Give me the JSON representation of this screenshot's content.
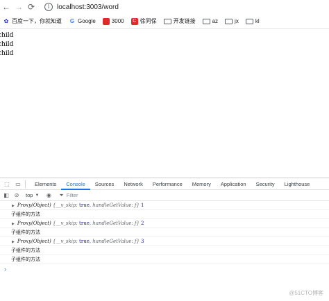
{
  "browser": {
    "back_icon": "←",
    "forward_icon": "→",
    "reload_icon": "⟳",
    "info_icon": "i",
    "url": "localhost:3003/word"
  },
  "bookmarks": [
    {
      "label": "百度一下，你就知道",
      "icon": "paw-icon",
      "glyph": "✿",
      "kind": "baidu"
    },
    {
      "label": "Google",
      "icon": "google-icon",
      "glyph": "G",
      "kind": "google"
    },
    {
      "label": "3000",
      "icon": "site-icon",
      "glyph": "",
      "kind": "red"
    },
    {
      "label": "徐同保",
      "icon": "csdn-icon",
      "glyph": "C",
      "kind": "red"
    },
    {
      "label": "开发链接",
      "icon": "folder-icon",
      "glyph": "",
      "kind": "folder"
    },
    {
      "label": "az",
      "icon": "folder-icon",
      "glyph": "",
      "kind": "folder"
    },
    {
      "label": "jx",
      "icon": "folder-icon",
      "glyph": "",
      "kind": "folder"
    },
    {
      "label": "kl",
      "icon": "folder-icon",
      "glyph": "",
      "kind": "folder"
    }
  ],
  "page": {
    "lines": [
      "child",
      "child",
      "child"
    ]
  },
  "devtools": {
    "tabs": [
      {
        "label": "Elements",
        "active": false
      },
      {
        "label": "Console",
        "active": true
      },
      {
        "label": "Sources",
        "active": false
      },
      {
        "label": "Network",
        "active": false
      },
      {
        "label": "Performance",
        "active": false
      },
      {
        "label": "Memory",
        "active": false
      },
      {
        "label": "Application",
        "active": false
      },
      {
        "label": "Security",
        "active": false
      },
      {
        "label": "Lighthouse",
        "active": false
      }
    ],
    "context": "top",
    "filter_placeholder": "Filter",
    "prompt": "›",
    "logs": [
      {
        "type": "obj",
        "prefix": "Proxy(Object)",
        "body_open": "{__v_skip: ",
        "kw": "true",
        "body_close": ", handleGetValue: ƒ}",
        "index": "1"
      },
      {
        "type": "msg",
        "text": "子组件的方法"
      },
      {
        "type": "obj",
        "prefix": "Proxy(Object)",
        "body_open": "{__v_skip: ",
        "kw": "true",
        "body_close": ", handleGetValue: ƒ}",
        "index": "2"
      },
      {
        "type": "msg",
        "text": "子组件的方法"
      },
      {
        "type": "obj",
        "prefix": "Proxy(Object)",
        "body_open": "{__v_skip: ",
        "kw": "true",
        "body_close": ", handleGetValue: ƒ}",
        "index": "3"
      },
      {
        "type": "msg",
        "text": "子组件的方法"
      },
      {
        "type": "msg",
        "text": "子组件的方法"
      }
    ]
  },
  "watermark": "@51CTO博客",
  "colors": {
    "accent": "#1a73e8",
    "keyword": "#1a1aa6"
  }
}
